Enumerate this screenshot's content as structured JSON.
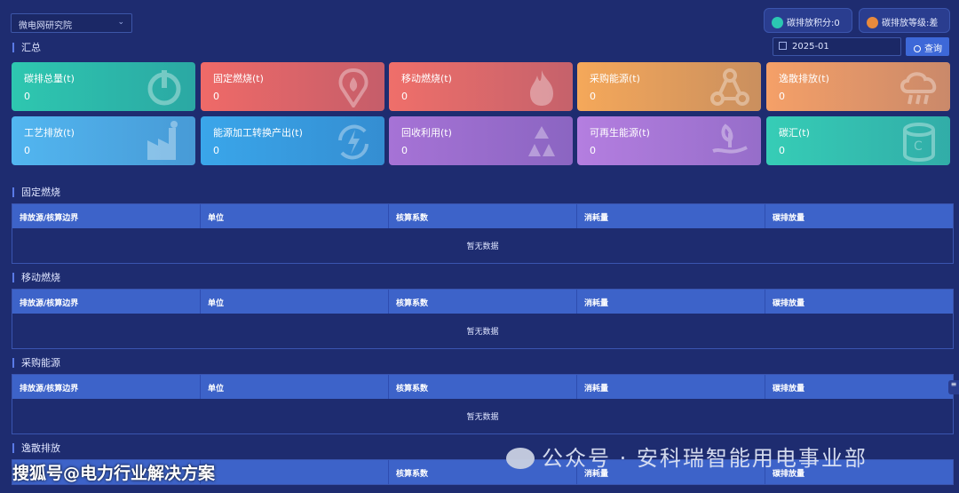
{
  "header": {
    "org_select": "微电网研究院",
    "score_label": "碳排放积分:0",
    "grade_label": "碳排放等级:差"
  },
  "summary": {
    "title": "汇总",
    "date": "2025-01",
    "query_label": "查询"
  },
  "cards": [
    {
      "label": "碳排总量(t)",
      "value": "0",
      "icon": "power-icon",
      "color": "#2ec7b0"
    },
    {
      "label": "固定燃烧(t)",
      "value": "0",
      "icon": "flame-pin-icon",
      "color": "#ef6a68"
    },
    {
      "label": "移动燃烧(t)",
      "value": "0",
      "icon": "fire-icon",
      "color": "#ef6f6a"
    },
    {
      "label": "采购能源(t)",
      "value": "0",
      "icon": "network-icon",
      "color": "#f5a85a"
    },
    {
      "label": "逸散排放(t)",
      "value": "0",
      "icon": "cloud-rain-icon",
      "color": "#f5a068"
    },
    {
      "label": "工艺排放(t)",
      "value": "0",
      "icon": "factory-icon",
      "color": "#52b6f0"
    },
    {
      "label": "能源加工转换产出(t)",
      "value": "0",
      "icon": "energy-cycle-icon",
      "color": "#3aa6ea"
    },
    {
      "label": "回收利用(t)",
      "value": "0",
      "icon": "recycle-icon",
      "color": "#a673d6"
    },
    {
      "label": "可再生能源(t)",
      "value": "0",
      "icon": "plant-hand-icon",
      "color": "#b47ee0"
    },
    {
      "label": "碳汇(t)",
      "value": "0",
      "icon": "carbon-stack-icon",
      "color": "#36cdb6"
    }
  ],
  "tables": [
    {
      "title": "固定燃烧",
      "columns": [
        "排放源/核算边界",
        "单位",
        "核算系数",
        "消耗量",
        "碳排放量"
      ],
      "empty": "暂无数据"
    },
    {
      "title": "移动燃烧",
      "columns": [
        "排放源/核算边界",
        "单位",
        "核算系数",
        "消耗量",
        "碳排放量"
      ],
      "empty": "暂无数据"
    },
    {
      "title": "采购能源",
      "columns": [
        "排放源/核算边界",
        "单位",
        "核算系数",
        "消耗量",
        "碳排放量"
      ],
      "empty": "暂无数据"
    },
    {
      "title": "逸散排放",
      "columns": [
        "",
        "",
        "核算系数",
        "消耗量",
        "碳排放量"
      ],
      "empty": ""
    }
  ],
  "watermarks": {
    "wechat": "公众号 · 安科瑞智能用电事业部",
    "sohu": "搜狐号@电力行业解决方案"
  },
  "side_tab": "≡"
}
